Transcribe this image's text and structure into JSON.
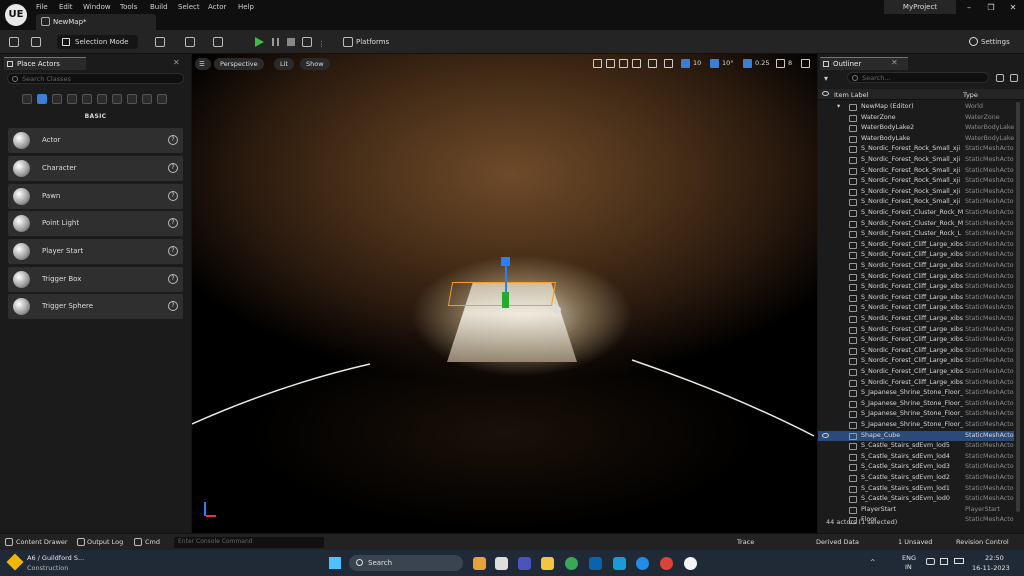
{
  "titlebar": {
    "logo": "UE",
    "menus": [
      "File",
      "Edit",
      "Window",
      "Tools",
      "Build",
      "Select",
      "Actor",
      "Help"
    ],
    "doc_tab": "NewMap*",
    "project": "MyProject",
    "window_buttons": [
      "–",
      "❐",
      "✕"
    ]
  },
  "toolbar": {
    "selection_mode": "Selection Mode",
    "platforms": "Platforms",
    "settings": "Settings"
  },
  "place_actors": {
    "tab": "Place Actors",
    "search_placeholder": "Search Classes",
    "section": "BASIC",
    "items": [
      {
        "label": "Actor"
      },
      {
        "label": "Character"
      },
      {
        "label": "Pawn"
      },
      {
        "label": "Point Light"
      },
      {
        "label": "Player Start"
      },
      {
        "label": "Trigger Box"
      },
      {
        "label": "Trigger Sphere"
      }
    ]
  },
  "viewport": {
    "perspective": "Perspective",
    "lit": "Lit",
    "show": "Show",
    "grid_snap": "10",
    "rot_snap": "10°",
    "scale_snap": "0.25",
    "cam_speed": "8"
  },
  "outliner": {
    "tab": "Outliner",
    "search_placeholder": "Search...",
    "col_label": "Item Label",
    "col_type": "Type",
    "rows": [
      {
        "label": "NewMap (Editor)",
        "type": "World"
      },
      {
        "label": "WaterZone",
        "type": "WaterZone"
      },
      {
        "label": "WaterBodyLake2",
        "type": "WaterBodyLake"
      },
      {
        "label": "WaterBodyLake",
        "type": "WaterBodyLake"
      },
      {
        "label": "S_Nordic_Forest_Rock_Small_xji",
        "type": "StaticMeshActor"
      },
      {
        "label": "S_Nordic_Forest_Rock_Small_xji",
        "type": "StaticMeshActor"
      },
      {
        "label": "S_Nordic_Forest_Rock_Small_xji",
        "type": "StaticMeshActor"
      },
      {
        "label": "S_Nordic_Forest_Rock_Small_xji",
        "type": "StaticMeshActor"
      },
      {
        "label": "S_Nordic_Forest_Rock_Small_xji",
        "type": "StaticMeshActor"
      },
      {
        "label": "S_Nordic_Forest_Rock_Small_xji",
        "type": "StaticMeshActor"
      },
      {
        "label": "S_Nordic_Forest_Cluster_Rock_M",
        "type": "StaticMeshActor"
      },
      {
        "label": "S_Nordic_Forest_Cluster_Rock_M",
        "type": "StaticMeshActor"
      },
      {
        "label": "S_Nordic_Forest_Cluster_Rock_L",
        "type": "StaticMeshActor"
      },
      {
        "label": "S_Nordic_Forest_Cliff_Large_xibs",
        "type": "StaticMeshActor"
      },
      {
        "label": "S_Nordic_Forest_Cliff_Large_xibs",
        "type": "StaticMeshActor"
      },
      {
        "label": "S_Nordic_Forest_Cliff_Large_xibs",
        "type": "StaticMeshActor"
      },
      {
        "label": "S_Nordic_Forest_Cliff_Large_xibs",
        "type": "StaticMeshActor"
      },
      {
        "label": "S_Nordic_Forest_Cliff_Large_xibs",
        "type": "StaticMeshActor"
      },
      {
        "label": "S_Nordic_Forest_Cliff_Large_xibs",
        "type": "StaticMeshActor"
      },
      {
        "label": "S_Nordic_Forest_Cliff_Large_xibs",
        "type": "StaticMeshActor"
      },
      {
        "label": "S_Nordic_Forest_Cliff_Large_xibs",
        "type": "StaticMeshActor"
      },
      {
        "label": "S_Nordic_Forest_Cliff_Large_xibs",
        "type": "StaticMeshActor"
      },
      {
        "label": "S_Nordic_Forest_Cliff_Large_xibs",
        "type": "StaticMeshActor"
      },
      {
        "label": "S_Nordic_Forest_Cliff_Large_xibs",
        "type": "StaticMeshActor"
      },
      {
        "label": "S_Nordic_Forest_Cliff_Large_xibs",
        "type": "StaticMeshActor"
      },
      {
        "label": "S_Nordic_Forest_Cliff_Large_xibs",
        "type": "StaticMeshActor"
      },
      {
        "label": "S_Nordic_Forest_Cliff_Large_xibs",
        "type": "StaticMeshActor"
      },
      {
        "label": "S_Japanese_Shrine_Stone_Floor_",
        "type": "StaticMeshActor"
      },
      {
        "label": "S_Japanese_Shrine_Stone_Floor_",
        "type": "StaticMeshActor"
      },
      {
        "label": "S_Japanese_Shrine_Stone_Floor_",
        "type": "StaticMeshActor"
      },
      {
        "label": "S_Japanese_Shrine_Stone_Floor_",
        "type": "StaticMeshActor"
      },
      {
        "label": "Shape_Cube",
        "type": "StaticMeshActor",
        "selected": true
      },
      {
        "label": "S_Castle_Stairs_sdEvm_lod5",
        "type": "StaticMeshActor"
      },
      {
        "label": "S_Castle_Stairs_sdEvm_lod4",
        "type": "StaticMeshActor"
      },
      {
        "label": "S_Castle_Stairs_sdEvm_lod3",
        "type": "StaticMeshActor"
      },
      {
        "label": "S_Castle_Stairs_sdEvm_lod2",
        "type": "StaticMeshActor"
      },
      {
        "label": "S_Castle_Stairs_sdEvm_lod1",
        "type": "StaticMeshActor"
      },
      {
        "label": "S_Castle_Stairs_sdEvm_lod0",
        "type": "StaticMeshActor"
      },
      {
        "label": "PlayerStart",
        "type": "PlayerStart"
      },
      {
        "label": "Floor",
        "type": "StaticMeshActor"
      }
    ],
    "footer": "44 actors (1 selected)"
  },
  "bottombar": {
    "content_drawer": "Content Drawer",
    "output_log": "Output Log",
    "cmd": "Cmd",
    "console_placeholder": "Enter Console Command",
    "trace": "Trace",
    "derived_data": "Derived Data",
    "unsaved": "1 Unsaved",
    "revision": "Revision Control"
  },
  "taskbar": {
    "weather_title": "A6 / Guildford S...",
    "weather_sub": "Construction",
    "search": "Search",
    "lang": "ENG",
    "lang_sub": "IN",
    "time": "22:50",
    "date": "16-11-2023"
  }
}
